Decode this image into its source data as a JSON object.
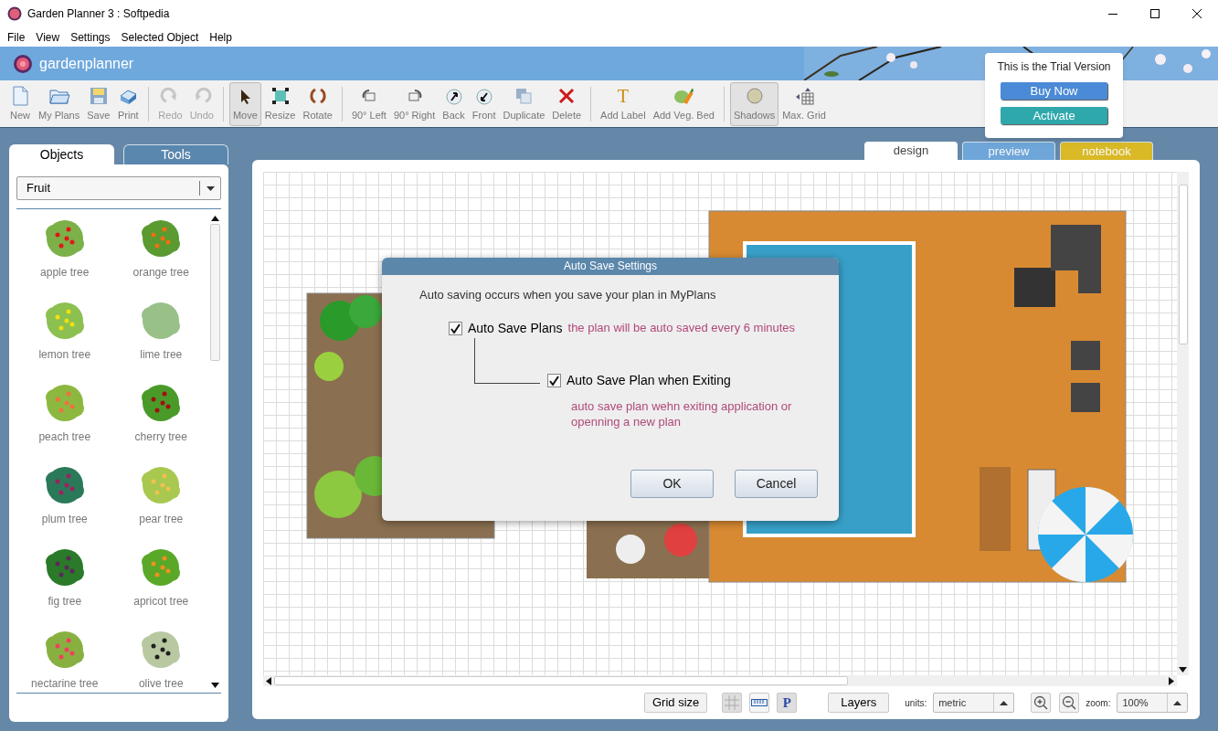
{
  "window": {
    "title": "Garden Planner 3 : Softpedia"
  },
  "menu": [
    "File",
    "View",
    "Settings",
    "Selected Object",
    "Help"
  ],
  "banner": {
    "logo": "gardenplanner"
  },
  "toolbar": {
    "groups": [
      [
        {
          "label": "New",
          "pressed": false,
          "disabled": false
        },
        {
          "label": "My Plans",
          "pressed": false,
          "disabled": false
        },
        {
          "label": "Save",
          "pressed": false,
          "disabled": false
        },
        {
          "label": "Print",
          "pressed": false,
          "disabled": false
        }
      ],
      [
        {
          "label": "Redo",
          "pressed": false,
          "disabled": true
        },
        {
          "label": "Undo",
          "pressed": false,
          "disabled": true
        }
      ],
      [
        {
          "label": "Move",
          "pressed": true,
          "disabled": false
        },
        {
          "label": "Resize",
          "pressed": false,
          "disabled": false
        },
        {
          "label": "Rotate",
          "pressed": false,
          "disabled": false
        }
      ],
      [
        {
          "label": "90° Left",
          "pressed": false,
          "disabled": false
        },
        {
          "label": "90° Right",
          "pressed": false,
          "disabled": false
        },
        {
          "label": "Back",
          "pressed": false,
          "disabled": false
        },
        {
          "label": "Front",
          "pressed": false,
          "disabled": false
        },
        {
          "label": "Duplicate",
          "pressed": false,
          "disabled": false
        },
        {
          "label": "Delete",
          "pressed": false,
          "disabled": false
        }
      ],
      [
        {
          "label": "Add Label",
          "glyph": "T",
          "pressed": false,
          "disabled": false
        },
        {
          "label": "Add Veg. Bed",
          "pressed": false,
          "disabled": false
        }
      ],
      [
        {
          "label": "Shadows",
          "pressed": true,
          "disabled": false
        },
        {
          "label": "Max. Grid",
          "pressed": false,
          "disabled": false
        }
      ]
    ]
  },
  "trial": {
    "text": "This is the Trial Version",
    "buttons": [
      "Buy Now",
      "Activate"
    ]
  },
  "left_panel": {
    "tabs": [
      {
        "label": "Objects",
        "selected": true
      },
      {
        "label": "Tools",
        "selected": false
      }
    ],
    "category": "Fruit",
    "items": [
      {
        "label": "apple tree"
      },
      {
        "label": "orange tree"
      },
      {
        "label": "lemon tree"
      },
      {
        "label": "lime tree"
      },
      {
        "label": "peach tree"
      },
      {
        "label": "cherry tree"
      },
      {
        "label": "plum tree"
      },
      {
        "label": "pear tree"
      },
      {
        "label": "fig tree"
      },
      {
        "label": "apricot tree"
      },
      {
        "label": "nectarine tree"
      },
      {
        "label": "olive tree"
      }
    ]
  },
  "view_tabs": [
    {
      "label": "design",
      "selected": true
    },
    {
      "label": "preview",
      "selected": false
    },
    {
      "label": "notebook",
      "selected": false
    }
  ],
  "dialog": {
    "title": "Auto Save Settings",
    "intro": "Auto saving occurs when you save your plan in MyPlans",
    "options": [
      {
        "label": "Auto Save Plans",
        "note": "the plan will be auto saved every 6 minutes",
        "checked": true
      },
      {
        "label": "Auto Save Plan when Exiting",
        "note": "auto save plan wehn exiting application or openning a new plan",
        "checked": true
      }
    ],
    "buttons": [
      "OK",
      "Cancel"
    ]
  },
  "bottom_bar": {
    "grid_button": "Grid size",
    "toggles": [
      {
        "kind": "grid",
        "selected": true
      },
      {
        "kind": "ruler",
        "selected": false
      },
      {
        "kind": "letter",
        "text": "P",
        "selected": true
      }
    ],
    "layers_button": "Layers",
    "units_label": "units:",
    "units": "metric",
    "zoom_label": "zoom:",
    "zoom": "100%"
  }
}
